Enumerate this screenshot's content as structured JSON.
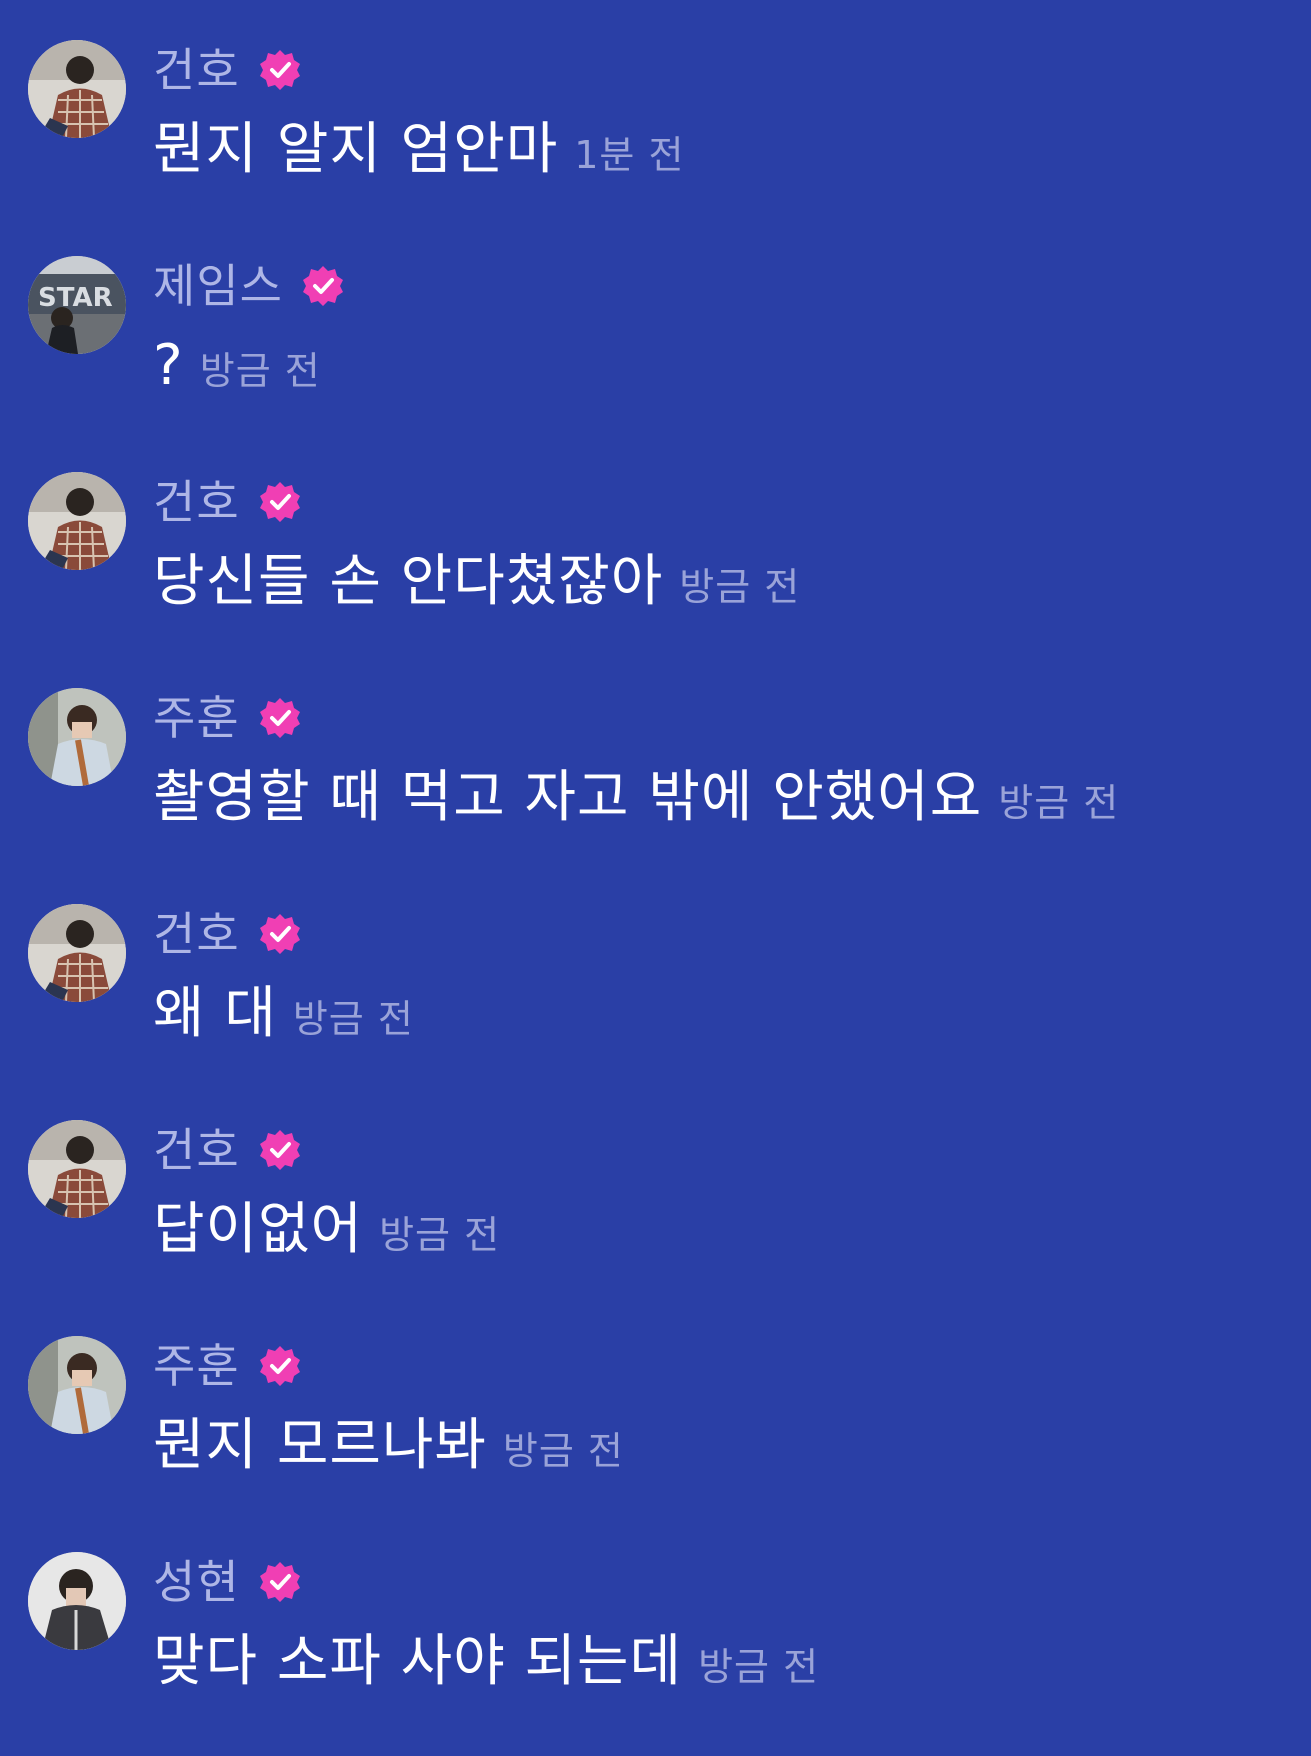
{
  "colors": {
    "background": "#2a3fa6",
    "name": "#aeb6e6",
    "time": "#9aa3d8",
    "text": "#ffffff",
    "badge": "#f03fb4"
  },
  "messages": [
    {
      "name": "건호",
      "text": "뭔지 알지 엄안마",
      "time": "1분 전",
      "badge_icon": "verified-badge-icon",
      "avatar": "user-avatar-plaid"
    },
    {
      "name": "제임스",
      "text": "?",
      "time": "방금 전",
      "badge_icon": "verified-badge-icon",
      "avatar": "user-avatar-star"
    },
    {
      "name": "건호",
      "text": "당신들 손 안다쳤잖아",
      "time": "방금 전",
      "badge_icon": "verified-badge-icon",
      "avatar": "user-avatar-plaid"
    },
    {
      "name": "주훈",
      "text": "촬영할 때 먹고 자고 밖에 안했어요",
      "time": "방금 전",
      "badge_icon": "verified-badge-icon",
      "avatar": "user-avatar-light"
    },
    {
      "name": "건호",
      "text": "왜 대",
      "time": "방금 전",
      "badge_icon": "verified-badge-icon",
      "avatar": "user-avatar-plaid"
    },
    {
      "name": "건호",
      "text": "답이없어",
      "time": "방금 전",
      "badge_icon": "verified-badge-icon",
      "avatar": "user-avatar-plaid"
    },
    {
      "name": "주훈",
      "text": "뭔지 모르나봐",
      "time": "방금 전",
      "badge_icon": "verified-badge-icon",
      "avatar": "user-avatar-light"
    },
    {
      "name": "성현",
      "text": "맞다 소파 사야 되는데",
      "time": "방금 전",
      "badge_icon": "verified-badge-icon",
      "avatar": "user-avatar-dark"
    }
  ]
}
